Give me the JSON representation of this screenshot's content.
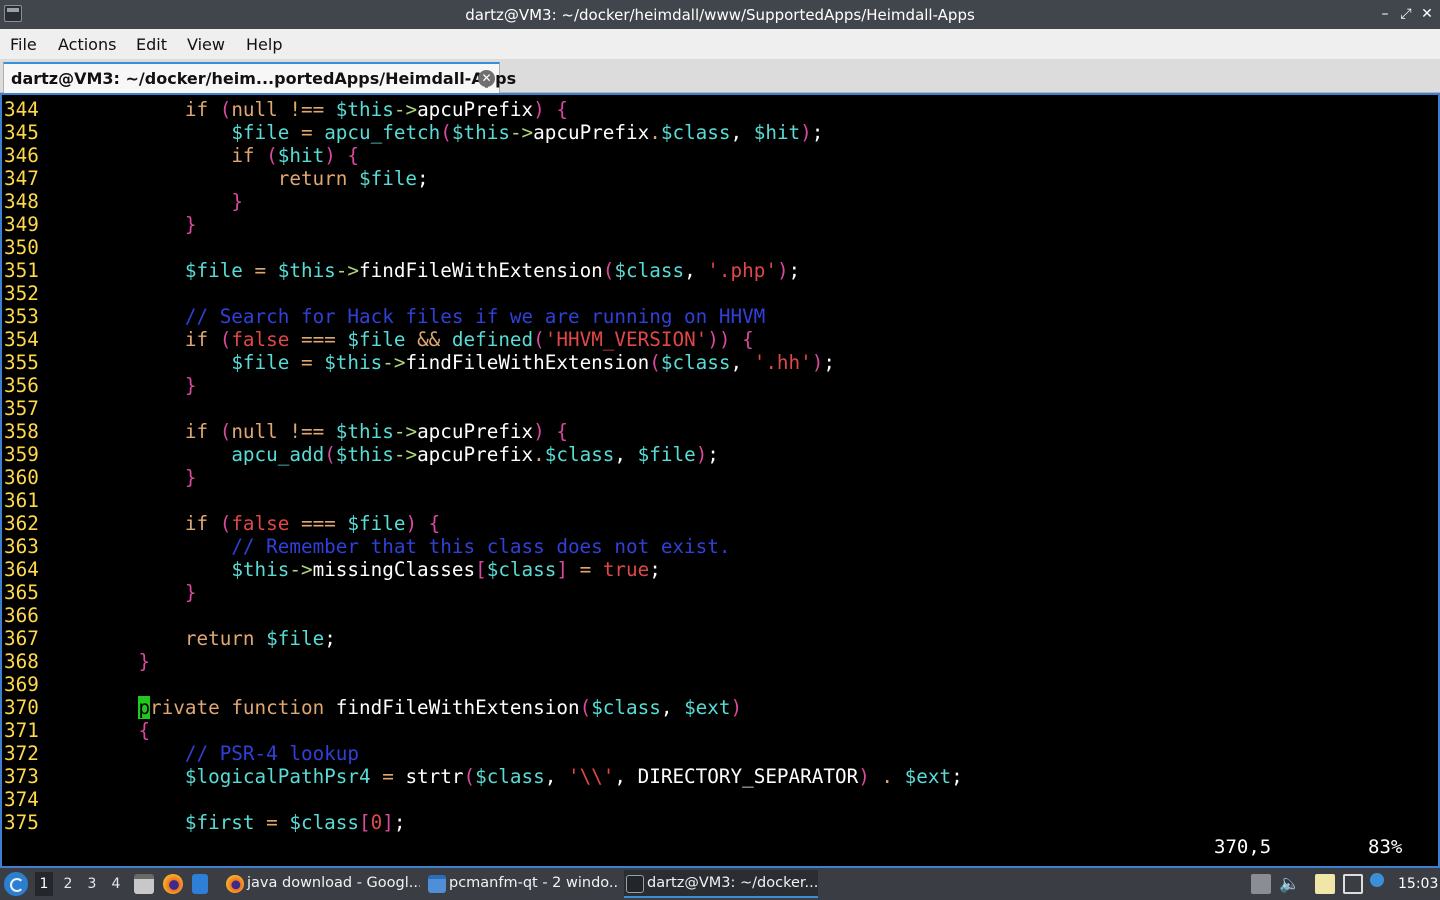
{
  "window": {
    "title": "dartz@VM3: ~/docker/heimdall/www/SupportedApps/Heimdall-Apps",
    "minimize_glyph": "–",
    "maximize_glyph": "⤢",
    "close_glyph": "✕"
  },
  "menu": {
    "items": [
      "File",
      "Actions",
      "Edit",
      "View",
      "Help"
    ]
  },
  "tab": {
    "label": "dartz@VM3: ~/docker/heim...portedApps/Heimdall-Apps",
    "close_glyph": "✕"
  },
  "colors": {
    "line_number": "#ffd94a",
    "keyword": "#e0a870",
    "variable": "#58dcd6",
    "paren": "#d94a9e",
    "string": "#e04848",
    "comment": "#3040d8",
    "cursor": "#1fc71f",
    "terminal_border": "#3f7fcf"
  },
  "code_lines": [
    {
      "n": "344",
      "tokens": [
        [
          "plain",
          "        "
        ],
        [
          "kw",
          "if "
        ],
        [
          "paren",
          "("
        ],
        [
          "kw",
          "null "
        ],
        [
          "op",
          "!== "
        ],
        [
          "var",
          "$this"
        ],
        [
          "arrow",
          "->"
        ],
        [
          "plain",
          "apcuPrefix"
        ],
        [
          "paren",
          ") {"
        ]
      ]
    },
    {
      "n": "345",
      "tokens": [
        [
          "plain",
          "            "
        ],
        [
          "var",
          "$file"
        ],
        [
          "op",
          " = "
        ],
        [
          "fn",
          "apcu_fetch"
        ],
        [
          "paren",
          "("
        ],
        [
          "var",
          "$this"
        ],
        [
          "arrow",
          "->"
        ],
        [
          "plain",
          "apcuPrefix"
        ],
        [
          "op",
          "."
        ],
        [
          "var",
          "$class"
        ],
        [
          "plain",
          ", "
        ],
        [
          "var",
          "$hit"
        ],
        [
          "paren",
          ")"
        ],
        [
          "plain",
          ";"
        ]
      ]
    },
    {
      "n": "346",
      "tokens": [
        [
          "plain",
          "            "
        ],
        [
          "kw",
          "if "
        ],
        [
          "paren",
          "("
        ],
        [
          "var",
          "$hit"
        ],
        [
          "paren",
          ") {"
        ]
      ]
    },
    {
      "n": "347",
      "tokens": [
        [
          "plain",
          "                "
        ],
        [
          "kw",
          "return "
        ],
        [
          "var",
          "$file"
        ],
        [
          "plain",
          ";"
        ]
      ]
    },
    {
      "n": "348",
      "tokens": [
        [
          "plain",
          "            "
        ],
        [
          "paren",
          "}"
        ]
      ]
    },
    {
      "n": "349",
      "tokens": [
        [
          "plain",
          "        "
        ],
        [
          "paren",
          "}"
        ]
      ]
    },
    {
      "n": "350",
      "tokens": []
    },
    {
      "n": "351",
      "tokens": [
        [
          "plain",
          "        "
        ],
        [
          "var",
          "$file"
        ],
        [
          "op",
          " = "
        ],
        [
          "var",
          "$this"
        ],
        [
          "arrow",
          "->"
        ],
        [
          "plain",
          "findFileWithExtension"
        ],
        [
          "paren",
          "("
        ],
        [
          "var",
          "$class"
        ],
        [
          "plain",
          ", "
        ],
        [
          "str",
          "'.php'"
        ],
        [
          "paren",
          ")"
        ],
        [
          "plain",
          ";"
        ]
      ]
    },
    {
      "n": "352",
      "tokens": []
    },
    {
      "n": "353",
      "tokens": [
        [
          "plain",
          "        "
        ],
        [
          "comment",
          "// Search for Hack files if we are running on HHVM"
        ]
      ]
    },
    {
      "n": "354",
      "tokens": [
        [
          "plain",
          "        "
        ],
        [
          "kw",
          "if "
        ],
        [
          "paren",
          "("
        ],
        [
          "bool",
          "false "
        ],
        [
          "op",
          "=== "
        ],
        [
          "var",
          "$file "
        ],
        [
          "op",
          "&& "
        ],
        [
          "fn",
          "defined"
        ],
        [
          "paren",
          "("
        ],
        [
          "str",
          "'HHVM_VERSION'"
        ],
        [
          "paren",
          ")) {"
        ]
      ]
    },
    {
      "n": "355",
      "tokens": [
        [
          "plain",
          "            "
        ],
        [
          "var",
          "$file"
        ],
        [
          "op",
          " = "
        ],
        [
          "var",
          "$this"
        ],
        [
          "arrow",
          "->"
        ],
        [
          "plain",
          "findFileWithExtension"
        ],
        [
          "paren",
          "("
        ],
        [
          "var",
          "$class"
        ],
        [
          "plain",
          ", "
        ],
        [
          "str",
          "'.hh'"
        ],
        [
          "paren",
          ")"
        ],
        [
          "plain",
          ";"
        ]
      ]
    },
    {
      "n": "356",
      "tokens": [
        [
          "plain",
          "        "
        ],
        [
          "paren",
          "}"
        ]
      ]
    },
    {
      "n": "357",
      "tokens": []
    },
    {
      "n": "358",
      "tokens": [
        [
          "plain",
          "        "
        ],
        [
          "kw",
          "if "
        ],
        [
          "paren",
          "("
        ],
        [
          "kw",
          "null "
        ],
        [
          "op",
          "!== "
        ],
        [
          "var",
          "$this"
        ],
        [
          "arrow",
          "->"
        ],
        [
          "plain",
          "apcuPrefix"
        ],
        [
          "paren",
          ") {"
        ]
      ]
    },
    {
      "n": "359",
      "tokens": [
        [
          "plain",
          "            "
        ],
        [
          "fn",
          "apcu_add"
        ],
        [
          "paren",
          "("
        ],
        [
          "var",
          "$this"
        ],
        [
          "arrow",
          "->"
        ],
        [
          "plain",
          "apcuPrefix"
        ],
        [
          "op",
          "."
        ],
        [
          "var",
          "$class"
        ],
        [
          "plain",
          ", "
        ],
        [
          "var",
          "$file"
        ],
        [
          "paren",
          ")"
        ],
        [
          "plain",
          ";"
        ]
      ]
    },
    {
      "n": "360",
      "tokens": [
        [
          "plain",
          "        "
        ],
        [
          "paren",
          "}"
        ]
      ]
    },
    {
      "n": "361",
      "tokens": []
    },
    {
      "n": "362",
      "tokens": [
        [
          "plain",
          "        "
        ],
        [
          "kw",
          "if "
        ],
        [
          "paren",
          "("
        ],
        [
          "bool",
          "false "
        ],
        [
          "op",
          "=== "
        ],
        [
          "var",
          "$file"
        ],
        [
          "paren",
          ") {"
        ]
      ]
    },
    {
      "n": "363",
      "tokens": [
        [
          "plain",
          "            "
        ],
        [
          "comment",
          "// Remember that this class does not exist."
        ]
      ]
    },
    {
      "n": "364",
      "tokens": [
        [
          "plain",
          "            "
        ],
        [
          "var",
          "$this"
        ],
        [
          "arrow",
          "->"
        ],
        [
          "plain",
          "missingClasses"
        ],
        [
          "paren",
          "["
        ],
        [
          "var",
          "$class"
        ],
        [
          "paren",
          "]"
        ],
        [
          "op",
          " = "
        ],
        [
          "bool",
          "true"
        ],
        [
          "plain",
          ";"
        ]
      ]
    },
    {
      "n": "365",
      "tokens": [
        [
          "plain",
          "        "
        ],
        [
          "paren",
          "}"
        ]
      ]
    },
    {
      "n": "366",
      "tokens": []
    },
    {
      "n": "367",
      "tokens": [
        [
          "plain",
          "        "
        ],
        [
          "kw",
          "return "
        ],
        [
          "var",
          "$file"
        ],
        [
          "plain",
          ";"
        ]
      ]
    },
    {
      "n": "368",
      "tokens": [
        [
          "plain",
          "    "
        ],
        [
          "paren",
          "}"
        ]
      ]
    },
    {
      "n": "369",
      "tokens": []
    },
    {
      "n": "370",
      "tokens": [
        [
          "plain",
          "    "
        ],
        [
          "cursor",
          "p"
        ],
        [
          "kw",
          "rivate "
        ],
        [
          "kw",
          "function "
        ],
        [
          "plain",
          "findFileWithExtension"
        ],
        [
          "paren",
          "("
        ],
        [
          "var",
          "$class"
        ],
        [
          "plain",
          ", "
        ],
        [
          "var",
          "$ext"
        ],
        [
          "paren",
          ")"
        ]
      ]
    },
    {
      "n": "371",
      "tokens": [
        [
          "plain",
          "    "
        ],
        [
          "paren",
          "{"
        ]
      ]
    },
    {
      "n": "372",
      "tokens": [
        [
          "plain",
          "        "
        ],
        [
          "comment",
          "// PSR-4 lookup"
        ]
      ]
    },
    {
      "n": "373",
      "tokens": [
        [
          "plain",
          "        "
        ],
        [
          "var",
          "$logicalPathPsr4"
        ],
        [
          "op",
          " = "
        ],
        [
          "plain",
          "strtr"
        ],
        [
          "paren",
          "("
        ],
        [
          "var",
          "$class"
        ],
        [
          "plain",
          ", "
        ],
        [
          "str",
          "'\\\\'"
        ],
        [
          "plain",
          ", DIRECTORY_SEPARATOR"
        ],
        [
          "paren",
          ")"
        ],
        [
          "op",
          " . "
        ],
        [
          "var",
          "$ext"
        ],
        [
          "plain",
          ";"
        ]
      ]
    },
    {
      "n": "374",
      "tokens": []
    },
    {
      "n": "375",
      "tokens": [
        [
          "plain",
          "        "
        ],
        [
          "var",
          "$first"
        ],
        [
          "op",
          " = "
        ],
        [
          "var",
          "$class"
        ],
        [
          "paren",
          "["
        ],
        [
          "str",
          "0"
        ],
        [
          "paren",
          "]"
        ],
        [
          "plain",
          ";"
        ]
      ]
    }
  ],
  "status": {
    "position": "370,5",
    "percent": "83%"
  },
  "taskbar": {
    "desktops": [
      "1",
      "2",
      "3",
      "4"
    ],
    "active_desktop": "1",
    "tasks": [
      {
        "label": "java download - Googl...",
        "icon": "firefox-icon"
      },
      {
        "label": "pcmanfm-qt - 2 windo...",
        "icon": "folder-icon"
      },
      {
        "label": "dartz@VM3: ~/docker...",
        "icon": "terminal-icon"
      }
    ],
    "clock": "15:03"
  }
}
